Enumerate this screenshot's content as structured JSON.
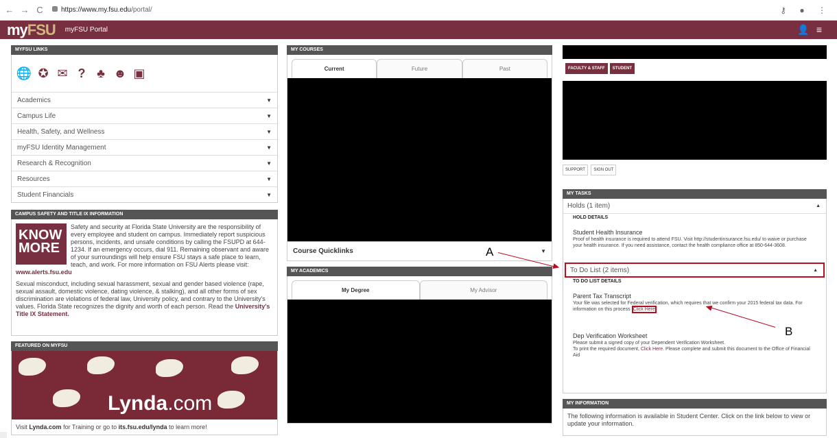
{
  "browser": {
    "back": "←",
    "forward": "→",
    "reload": "C",
    "url_host": "https://www.my.fsu.edu",
    "url_path": "/portal/"
  },
  "header": {
    "logo_my": "my",
    "logo_fsu": "FSU",
    "portal_name": "myFSU Portal"
  },
  "links": {
    "title": "MYFSU LINKS",
    "items": [
      {
        "label": "Academics"
      },
      {
        "label": "Campus Life"
      },
      {
        "label": "Health, Safety, and Wellness"
      },
      {
        "label": "myFSU Identity Management"
      },
      {
        "label": "Research & Recognition"
      },
      {
        "label": "Resources"
      },
      {
        "label": "Student Financials"
      }
    ]
  },
  "safety": {
    "title": "CAMPUS SAFETY AND TITLE IX INFORMATION",
    "know": "KNOW",
    "more": "MORE",
    "para1": "Safety and security at Florida State University are the responsibility of every employee and student on campus. Immediately report suspicious persons, incidents, and unsafe conditions by calling the FSUPD at 644-1234. If an emergency occurs, dial 911. Remaining observant and aware of your surroundings will help ensure FSU stays a safe place to learn, teach, and work. For more information on FSU Alerts please visit:",
    "alerts_link": "www.alerts.fsu.edu",
    "para2": "Sexual misconduct, including sexual harassment, sexual and gender based violence (rape, sexual assault, domestic violence, dating violence, & stalking), and all other forms of sex discrimination are violations of federal law, University policy, and contrary to the University's values. Florida State recognizes the dignity and worth of each person. Read the",
    "title_ix_link": "University's Title IX Statement."
  },
  "featured": {
    "title": "FEATURED ON MYFSU",
    "brand": "Lynda",
    "brand_suffix": ".com",
    "caption_pre": "Visit",
    "caption_link1": "Lynda.com",
    "caption_mid": "for Training or go to",
    "caption_link2": "its.fsu.edu/lynda",
    "caption_post": "to learn more!"
  },
  "courses": {
    "title": "MY COURSES",
    "tabs": [
      {
        "label": "Current"
      },
      {
        "label": "Future"
      },
      {
        "label": "Past"
      }
    ],
    "quicklinks": "Course Quicklinks"
  },
  "academics": {
    "title": "MY ACADEMICS",
    "tabs": [
      {
        "label": "My Degree"
      },
      {
        "label": "My Advisor"
      }
    ]
  },
  "account": {
    "role_buttons": [
      {
        "label": "FACULTY & STAFF"
      },
      {
        "label": "STUDENT"
      }
    ],
    "support": "SUPPORT",
    "signout": "SIGN OUT"
  },
  "tasks": {
    "title": "MY TASKS",
    "holds": "Holds (1 item)",
    "hold_details": "HOLD DETAILS",
    "hold_title": "Student Health Insurance",
    "hold_text": "Proof of health insurance is required to attend FSU. Visit http://studentinsurance.fsu.edu/ to waive or purchase your health insurance. If you need assistance, contact the health compliance office at 850-644-3608.",
    "todo": "To Do List (2 items)",
    "todo_details": "TO DO LIST DETAILS",
    "todo1_title": "Parent Tax Transcript",
    "todo1_text": "Your file was selected for Federal verification, which requires that we confirm your 2015 federal tax data. For information on this process",
    "todo1_link": "Click Here",
    "todo2_title": "Dep Verification Worksheet",
    "todo2_text1": "Please submit a signed copy of your Dependent Verification Worksheet.",
    "todo2_text2_pre": "To print the required document,",
    "todo2_link": "Click Here",
    "todo2_text2_post": ". Please complete and submit this document to the Office of Financial Aid"
  },
  "info": {
    "title": "MY INFORMATION",
    "text": "The following information is available in Student Center. Click on the link below to view or update your information."
  },
  "annotations": {
    "a": "A",
    "b": "B"
  },
  "colors": {
    "garnet": "#782f40",
    "gold": "#cdb87d",
    "highlight": "#b80d1d"
  }
}
